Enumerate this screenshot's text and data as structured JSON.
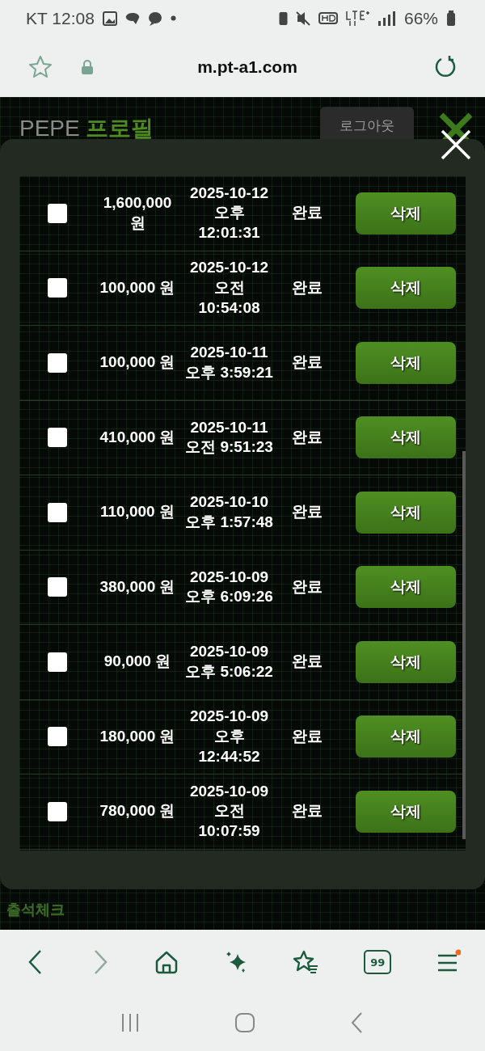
{
  "status_bar": {
    "carrier": "KT",
    "time": "12:08",
    "battery": "66%"
  },
  "browser": {
    "url": "m.pt-a1.com",
    "tab_count": "99"
  },
  "header": {
    "brand": "PEPE",
    "title": "프로필",
    "logout": "로그아웃"
  },
  "rows": [
    {
      "amount": "1,600,000 원",
      "date": "2025-10-12 오후 12:01:31",
      "status": "완료",
      "action": "삭제",
      "checked": false
    },
    {
      "amount": "100,000 원",
      "date": "2025-10-12 오전 10:54:08",
      "status": "완료",
      "action": "삭제",
      "checked": false
    },
    {
      "amount": "100,000 원",
      "date": "2025-10-11 오후 3:59:21",
      "status": "완료",
      "action": "삭제",
      "checked": false
    },
    {
      "amount": "410,000 원",
      "date": "2025-10-11 오전 9:51:23",
      "status": "완료",
      "action": "삭제",
      "checked": false
    },
    {
      "amount": "110,000 원",
      "date": "2025-10-10 오후 1:57:48",
      "status": "완료",
      "action": "삭제",
      "checked": false
    },
    {
      "amount": "380,000 원",
      "date": "2025-10-09 오후 6:09:26",
      "status": "완료",
      "action": "삭제",
      "checked": false
    },
    {
      "amount": "90,000 원",
      "date": "2025-10-09 오후 5:06:22",
      "status": "완료",
      "action": "삭제",
      "checked": false
    },
    {
      "amount": "180,000 원",
      "date": "2025-10-09 오후 12:44:52",
      "status": "완료",
      "action": "삭제",
      "checked": false
    },
    {
      "amount": "780,000 원",
      "date": "2025-10-09 오전 10:07:59",
      "status": "완료",
      "action": "삭제",
      "checked": false
    }
  ],
  "footer_badge": "출석체크"
}
